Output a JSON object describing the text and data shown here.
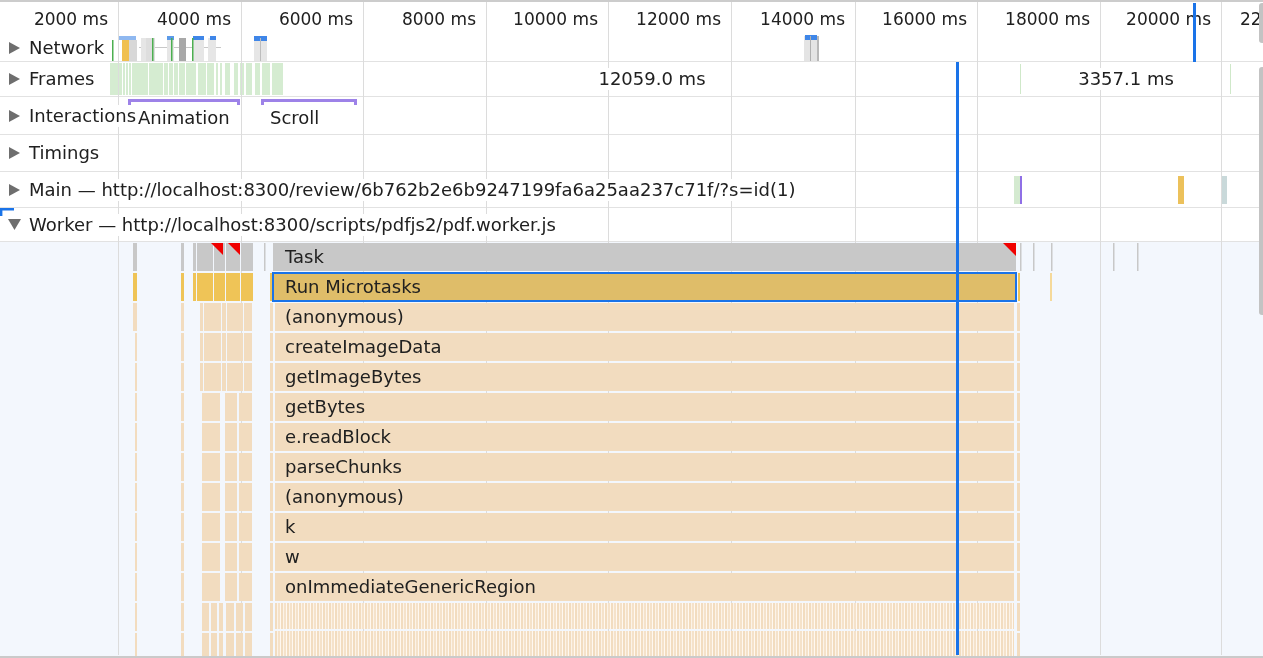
{
  "ruler": {
    "ticks": [
      "2000 ms",
      "4000 ms",
      "6000 ms",
      "8000 ms",
      "10000 ms",
      "12000 ms",
      "14000 ms",
      "16000 ms",
      "18000 ms",
      "20000 ms",
      "22"
    ]
  },
  "tracks": [
    {
      "kind": "network",
      "label": "Network",
      "expanded": false,
      "selected": false
    },
    {
      "kind": "frames",
      "label": "Frames",
      "expanded": false,
      "selected": false,
      "frames": [
        "12059.0 ms",
        "3357.1 ms"
      ]
    },
    {
      "kind": "interactions",
      "label": "Interactions",
      "expanded": false,
      "selected": false,
      "interactions": [
        "Animation",
        "Scroll"
      ]
    },
    {
      "kind": "timings",
      "label": "Timings",
      "expanded": false,
      "selected": false
    },
    {
      "kind": "thread",
      "label": "Main — http://localhost:8300/review/6b762b2e6b9247199fa6a25aa237c71f/?s=id(1)",
      "expanded": false,
      "selected": false
    },
    {
      "kind": "thread",
      "label": "Worker — http://localhost:8300/scripts/pdfjs2/pdf.worker.js",
      "expanded": true,
      "selected": true,
      "flame": [
        {
          "name": "Task",
          "kind": "task",
          "selected": false,
          "long_task": true
        },
        {
          "name": "Run Microtasks",
          "kind": "microtasks",
          "selected": true,
          "long_task": false
        },
        {
          "name": "(anonymous)",
          "kind": "function",
          "selected": false,
          "long_task": false
        },
        {
          "name": "createImageData",
          "kind": "function",
          "selected": false,
          "long_task": false
        },
        {
          "name": "getImageBytes",
          "kind": "function",
          "selected": false,
          "long_task": false
        },
        {
          "name": "getBytes",
          "kind": "function",
          "selected": false,
          "long_task": false
        },
        {
          "name": "e.readBlock",
          "kind": "function",
          "selected": false,
          "long_task": false
        },
        {
          "name": "parseChunks",
          "kind": "function",
          "selected": false,
          "long_task": false
        },
        {
          "name": "(anonymous)",
          "kind": "function",
          "selected": false,
          "long_task": false
        },
        {
          "name": "k",
          "kind": "function",
          "selected": false,
          "long_task": false
        },
        {
          "name": "w",
          "kind": "function",
          "selected": false,
          "long_task": false
        },
        {
          "name": "onImmediateGenericRegion",
          "kind": "function",
          "selected": false,
          "long_task": false
        }
      ]
    }
  ]
}
